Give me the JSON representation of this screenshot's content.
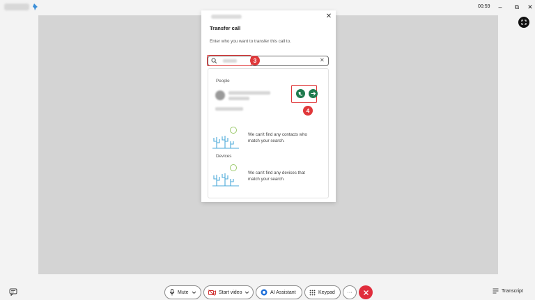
{
  "titlebar": {
    "timer": "00:59",
    "minimize_icon": "minimize-icon",
    "restore_icon": "restore-icon",
    "close_icon": "close-icon"
  },
  "dialog": {
    "title": "Transfer call",
    "subtitle": "Enter who you want to transfer this call to.",
    "close_icon": "close-icon",
    "search": {
      "icon": "search-icon",
      "clear_icon": "clear-icon"
    },
    "people_label": "People",
    "people_empty": "We can't find any contacts who match your search.",
    "devices_label": "Devices",
    "devices_empty": "We can't find any devices that match your search.",
    "contact_actions": [
      "consult-icon",
      "arrow-right-icon"
    ]
  },
  "annotations": {
    "step3": "3",
    "step4": "4",
    "color": "#e0383a"
  },
  "controls": {
    "mute": "Mute",
    "start_video": "Start video",
    "ai_assistant": "AI Assistant",
    "keypad": "Keypad",
    "more": "···",
    "transcript": "Transcript",
    "end_call_color": "#e02d3c",
    "accent": "#1f7a4d"
  }
}
